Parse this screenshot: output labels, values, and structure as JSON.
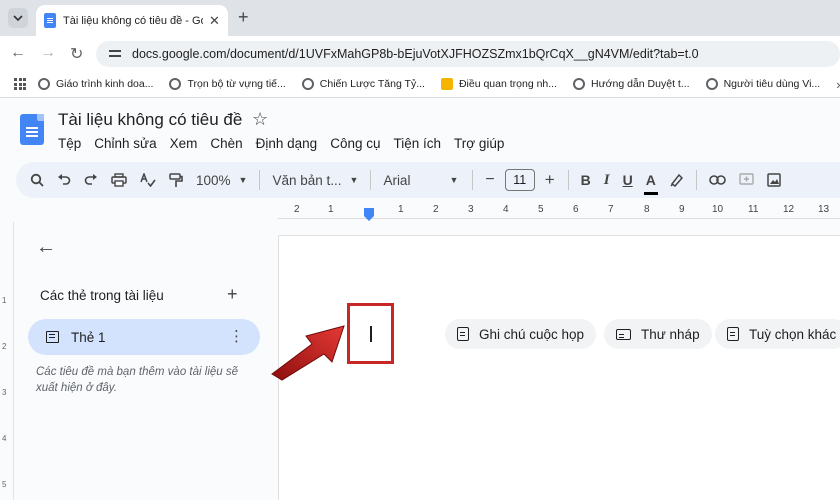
{
  "browser": {
    "tab_title": "Tài liệu không có tiêu đề - Goo",
    "tab_close": "✕",
    "new_tab": "+",
    "back": "←",
    "forward": "→",
    "reload": "↻",
    "url": "docs.google.com/document/d/1UVFxMahGP8b-bEjuVotXJFHOZSZmx1bQrCqX__gN4VM/edit?tab=t.0"
  },
  "bookmarks": [
    {
      "label": "Giáo trình kinh doa...",
      "icon": "globe-icon"
    },
    {
      "label": "Trọn bộ từ vựng tiế...",
      "icon": "globe-icon"
    },
    {
      "label": "Chiến Lược Tăng Tỷ...",
      "icon": "globe-icon"
    },
    {
      "label": "Điều quan trọng nh...",
      "icon": "warning-icon"
    },
    {
      "label": "Hướng dẫn Duyệt t...",
      "icon": "globe-icon"
    },
    {
      "label": "Người tiêu dùng Vi...",
      "icon": "globe-icon"
    }
  ],
  "bookmarks_more": "»",
  "docs": {
    "title": "Tài liệu không có tiêu đề",
    "star": "☆",
    "menu": [
      "Tệp",
      "Chỉnh sửa",
      "Xem",
      "Chèn",
      "Định dạng",
      "Công cụ",
      "Tiện ích",
      "Trợ giúp"
    ]
  },
  "toolbar": {
    "zoom": "100%",
    "style": "Văn bản t...",
    "font": "Arial",
    "font_size": "11",
    "minus": "−",
    "plus": "+",
    "bold": "B",
    "italic": "I",
    "underline": "U",
    "text_color": "A"
  },
  "ruler": {
    "numbers": [
      "2",
      "1",
      "1",
      "2",
      "3",
      "4",
      "5",
      "6",
      "7",
      "8",
      "9",
      "10",
      "11",
      "12",
      "13"
    ]
  },
  "vruler": {
    "numbers": [
      "1",
      "2",
      "3",
      "4",
      "5"
    ]
  },
  "sidebar": {
    "back": "←",
    "heading": "Các thẻ trong tài liệu",
    "add": "+",
    "tab_label": "Thẻ 1",
    "kebab": "⋮",
    "hint": "Các tiêu đề mà bạn thêm vào tài liệu sẽ xuất hiện ở đây."
  },
  "chips": [
    "Ghi chú cuộc họp",
    "Thư nháp",
    "Tuỳ chọn khác"
  ],
  "colors": {
    "accent": "#4285f4",
    "annotation": "#c62828",
    "selected_tab": "#d3e3fd",
    "toolbar_bg": "#edf2fa"
  }
}
